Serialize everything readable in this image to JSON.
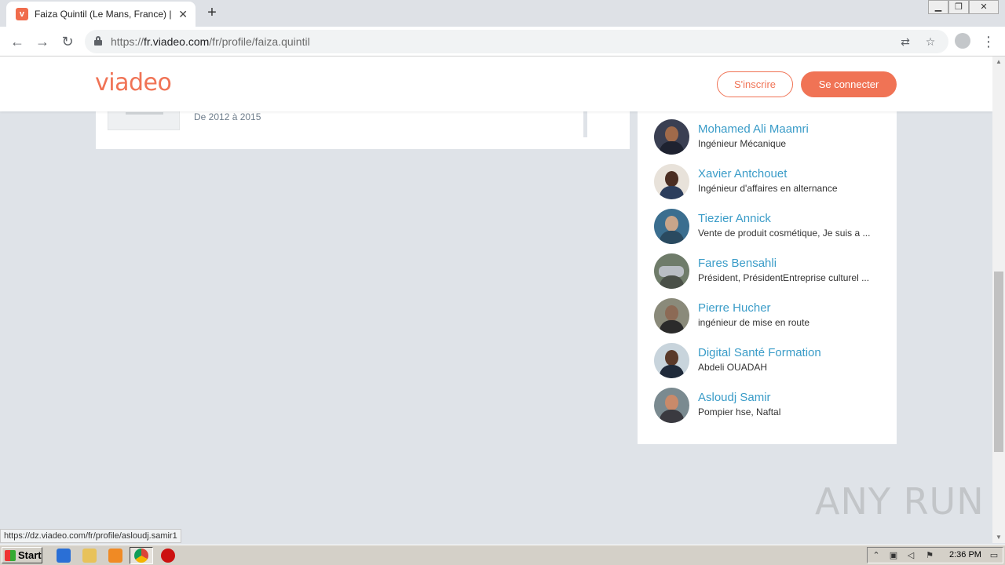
{
  "browser": {
    "tab_title": "Faiza Quintil (Le Mans, France) | Viadeo",
    "url_prefix": "https://",
    "url_host": "fr.viadeo.com",
    "url_path": "/fr/profile/faiza.quintil",
    "status_url": "https://dz.viadeo.com/fr/profile/asloudj.samir1"
  },
  "header": {
    "logo_text": "viadeo",
    "signup_label": "S'inscrire",
    "login_label": "Se connecter",
    "accent_color": "#f07355"
  },
  "education": {
    "dates": "De 2012 à 2015"
  },
  "people": [
    {
      "name": "Mohamed Ali Maamri",
      "title": "Ingénieur Mécanique"
    },
    {
      "name": "Xavier Antchouet",
      "title": "Ingénieur d'affaires en alternance"
    },
    {
      "name": "Tiezier Annick",
      "title": "Vente de produit cosmétique, Je suis a ..."
    },
    {
      "name": "Fares Bensahli",
      "title": "Président, PrésidentEntreprise culturel ..."
    },
    {
      "name": "Pierre Hucher",
      "title": "ingénieur de mise en route"
    },
    {
      "name": "Digital Santé Formation",
      "title": "Abdeli OUADAH"
    },
    {
      "name": "Asloudj Samir",
      "title": "Pompier hse, Naftal"
    }
  ],
  "watermark": "ANY RUN",
  "taskbar": {
    "start_label": "Start",
    "clock": "2:36 PM"
  }
}
